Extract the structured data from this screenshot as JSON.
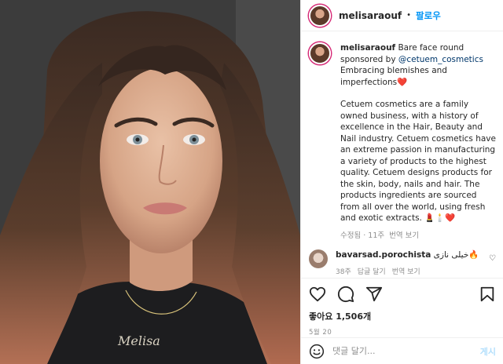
{
  "post": {
    "username": "melisaraouf",
    "follow_label": "팔로우",
    "dot": "•"
  },
  "caption": {
    "username": "melisaraouf",
    "line1": "Bare face round sponsored by ",
    "mention": "@cetuem_cosmetics",
    "line2": "Embracing blemishes and imperfections❤️",
    "paragraph": "Cetuem cosmetics are a family owned business, with a history of excellence in the Hair, Beauty and Nail industry. Cetuem cosmetics have an extreme passion in manufacturing a variety of products to the highest quality. Cetuem designs products for the skin, body, nails and hair. The products ingredients are sourced from all over the world, using fresh and exotic extracts. 💄🕯️❤️",
    "edited": "수정됨 · 11주",
    "translate": "번역 보기"
  },
  "comment": {
    "username": "bavarsad.porochista",
    "text": "خیلی نازی🔥",
    "meta_time": "38주",
    "meta_reply": "답글 달기",
    "meta_translate": "번역 보기"
  },
  "actions": {
    "likes": "좋아요 1,506개",
    "date": "5월 20",
    "comment_placeholder": "댓글 달기...",
    "post_label": "게시"
  },
  "photo": {
    "necklace_text": "Melisa"
  },
  "colors": {
    "follow": "#0095f6",
    "mention": "#00376b",
    "heart": "#ed4956"
  },
  "icons": [
    "heart-icon",
    "comment-icon",
    "share-icon",
    "save-icon",
    "emoji-icon"
  ]
}
